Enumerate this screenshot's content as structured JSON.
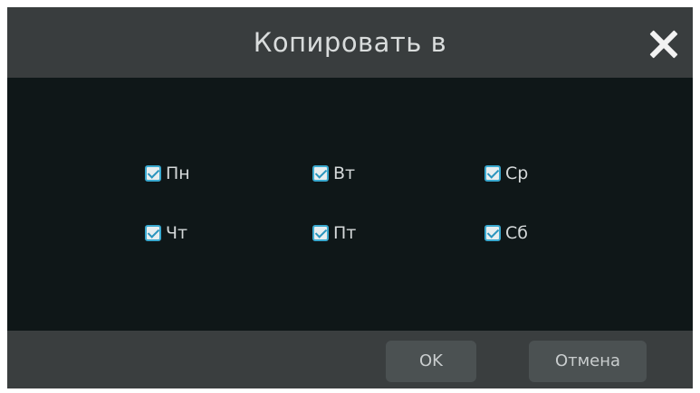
{
  "dialog": {
    "title": "Копировать в",
    "close_icon": "close-icon"
  },
  "days": [
    {
      "label": "Пн",
      "checked": true
    },
    {
      "label": "Вт",
      "checked": true
    },
    {
      "label": "Ср",
      "checked": true
    },
    {
      "label": "Чт",
      "checked": true
    },
    {
      "label": "Пт",
      "checked": true
    },
    {
      "label": "Сб",
      "checked": true
    }
  ],
  "buttons": {
    "ok_label": "OK",
    "cancel_label": "Отмена"
  },
  "colors": {
    "checkbox_accent": "#3aa9cf",
    "panel_background": "#0f1718",
    "chrome_background": "#3a3e3f"
  }
}
